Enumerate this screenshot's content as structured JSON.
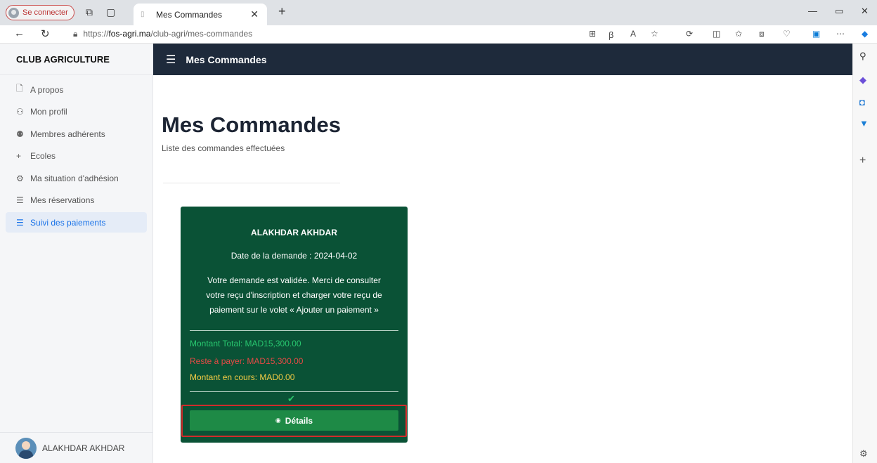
{
  "browser": {
    "profile_label": "Se connecter",
    "tab_title": "Mes Commandes",
    "url_prefix": "https://",
    "url_domain": "fos-agri.ma",
    "url_path": "/club-agri/mes-commandes"
  },
  "sidebar": {
    "brand": "CLUB AGRICULTURE",
    "items": [
      {
        "label": "A propos",
        "icon": "file-icon"
      },
      {
        "label": "Mon profil",
        "icon": "user-icon"
      },
      {
        "label": "Membres adhérents",
        "icon": "group-icon"
      },
      {
        "label": "Ecoles",
        "icon": "plus-icon"
      },
      {
        "label": "Ma situation d'adhésion",
        "icon": "gear-icon"
      },
      {
        "label": "Mes réservations",
        "icon": "list-icon"
      },
      {
        "label": "Suivi des paiements",
        "icon": "list-icon",
        "active": true
      }
    ],
    "user_name": "ALAKHDAR AKHDAR"
  },
  "header": {
    "title": "Mes Commandes"
  },
  "main": {
    "title": "Mes Commandes",
    "subtitle": "Liste des commandes effectuées"
  },
  "order_card": {
    "name": "ALAKHDAR AKHDAR",
    "date_line": "Date de la demande : 2024-04-02",
    "message": "Votre demande est validée. Merci de consulter votre reçu d'inscription et charger votre reçu de paiement sur le volet « Ajouter un paiement »",
    "montant_total": "Montant Total: MAD15,300.00",
    "reste_a_payer": "Reste à payer: MAD15,300.00",
    "montant_en_cours": "Montant en cours: MAD0.00",
    "details_button": "Détails"
  },
  "colors": {
    "card_bg": "#0a5236",
    "header_bg": "#1e2a3b",
    "total_green": "#28c76f",
    "rest_red": "#e54a45",
    "current_yellow": "#f5cc45",
    "button_green": "#1e8a46",
    "highlight_red": "#d12b2b"
  }
}
